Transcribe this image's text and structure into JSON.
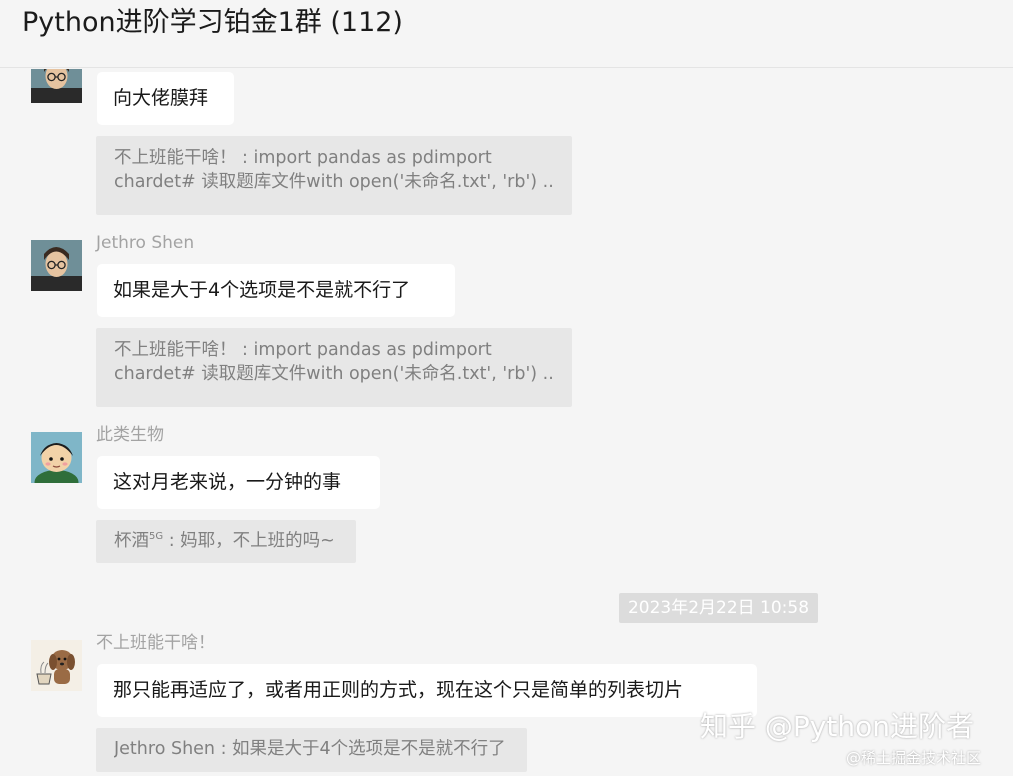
{
  "header": {
    "title": "Python进阶学习铂金1群 (112)"
  },
  "messages": [
    {
      "avatar": "person-with-glasses-avatar",
      "text": "向大佬膜拜",
      "quote": [
        "不上班能干啥！ : import pandas as pdimport",
        "chardet# 读取题库文件with open('未命名.txt', 'rb') ..."
      ]
    },
    {
      "sender": "Jethro Shen",
      "avatar": "person-with-glasses-avatar",
      "text": "如果是大于4个选项是不是就不行了",
      "quote": [
        "不上班能干啥！ : import pandas as pdimport",
        "chardet# 读取题库文件with open('未命名.txt', 'rb') ..."
      ]
    },
    {
      "sender": "此类生物",
      "avatar": "cartoon-character-avatar",
      "text": "这对月老来说，一分钟的事",
      "quote_name": "杯酒",
      "quote_sup": "5G",
      "quote_rest": " : 妈耶，不上班的吗~"
    },
    {
      "timestamp": "2023年2月22日 10:58"
    },
    {
      "sender": "不上班能干啥！",
      "avatar": "dog-drawing-avatar",
      "text": "那只能再适应了，或者用正则的方式，现在这个只是简单的列表切片",
      "quote": [
        "Jethro Shen : 如果是大于4个选项是不是就不行了"
      ]
    }
  ],
  "watermark": {
    "main": "知乎 @Python进阶者",
    "sub": "@稀土掘金技术社区"
  },
  "colors": {
    "background": "#f5f5f5",
    "bubble": "#ffffff",
    "quote": "#e7e7e7",
    "timestamp_bg": "#dcdcdc"
  }
}
